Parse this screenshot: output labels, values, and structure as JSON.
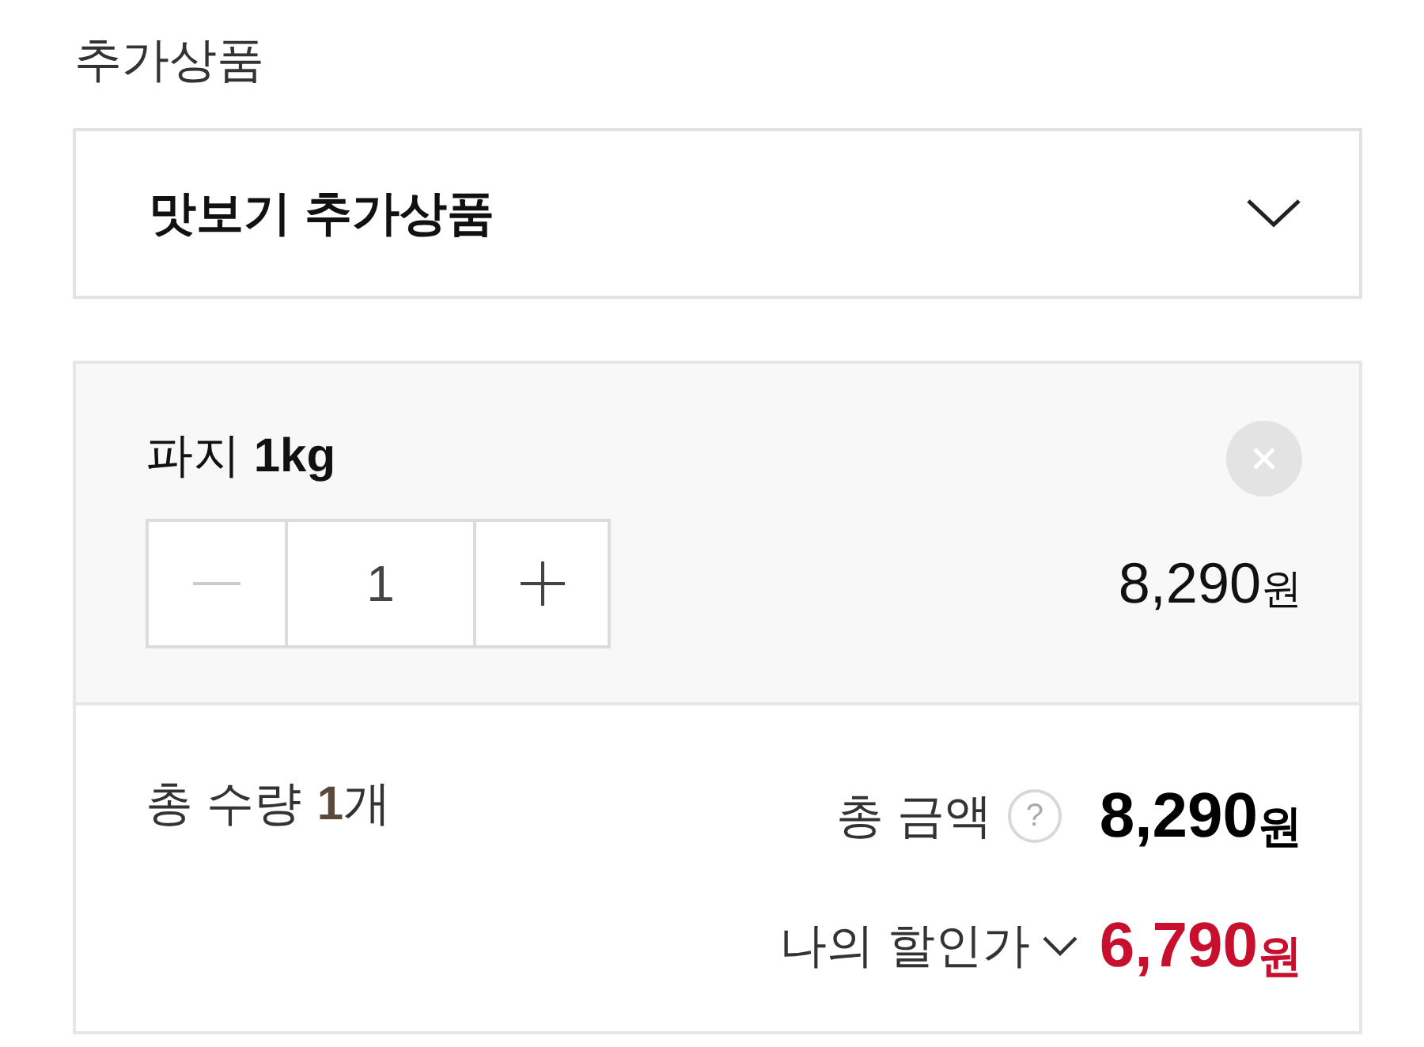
{
  "section_title": "추가상품",
  "dropdown": {
    "value": "맛보기 추가상품",
    "expanded": false
  },
  "items": [
    {
      "name": "파지 **1kg**",
      "quantity": "1",
      "price": "8,290",
      "currency": "원"
    }
  ],
  "summary": {
    "quantity_label": "총 수량",
    "quantity": "1",
    "quantity_unit": "개",
    "total_label": "총 금액",
    "help": "?",
    "total": "8,290",
    "total_currency": "원",
    "discount_label": "나의 할인가",
    "discount": "6,790",
    "discount_currency": "원"
  }
}
